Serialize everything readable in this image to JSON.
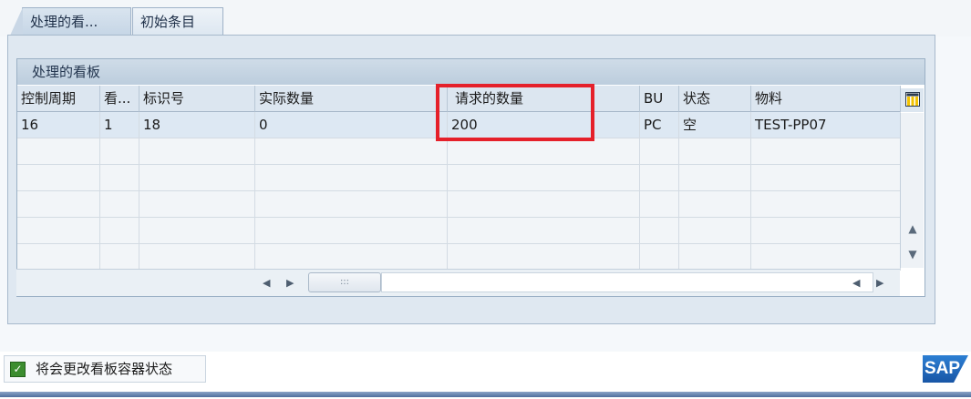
{
  "tabs": [
    {
      "label": "处理的看..."
    },
    {
      "label": "初始条目"
    }
  ],
  "table": {
    "title": "处理的看板",
    "columns": [
      "控制周期",
      "看...",
      "标识号",
      "实际数量",
      "请求的数量",
      "BU",
      "状态",
      "物料"
    ],
    "rows": [
      [
        "16",
        "1",
        "18",
        "0",
        "200",
        "PC",
        "空",
        "TEST-PP07"
      ]
    ],
    "config_icon": "table-settings-icon"
  },
  "status": {
    "message": "将会更改看板容器状态",
    "icon": "success-check-icon"
  },
  "brand": {
    "logo_text": "SAP"
  },
  "colors": {
    "highlight": "#e5202a",
    "accent": "#1856a6"
  }
}
